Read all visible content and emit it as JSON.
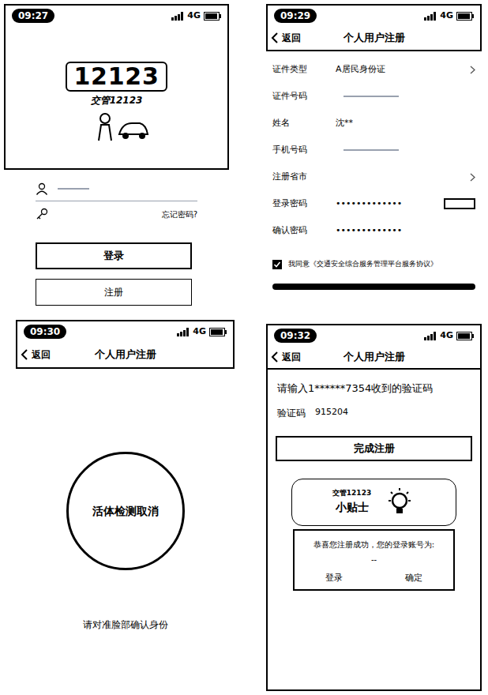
{
  "login": {
    "time": "09:27",
    "network": "4G",
    "logo_number": "12123",
    "logo_subtitle": "交管12123",
    "forgot": "忘记密码?",
    "login_button": "登录",
    "register_button": "注册"
  },
  "register": {
    "time": "09:29",
    "network": "4G",
    "back": "返回",
    "title": "个人用户注册",
    "fields": [
      {
        "label": "证件类型",
        "value": "A居民身份证",
        "kind": "select"
      },
      {
        "label": "证件号码",
        "kind": "redacted"
      },
      {
        "label": "姓名",
        "value": "沈**",
        "kind": "text"
      },
      {
        "label": "手机号码",
        "kind": "redacted"
      },
      {
        "label": "注册省市",
        "kind": "select"
      },
      {
        "label": "登录密码",
        "value": "•••••••••••••",
        "kind": "password"
      },
      {
        "label": "确认密码",
        "value": "•••••••••••••",
        "kind": "text"
      }
    ],
    "agreement": {
      "label": "我同意《交通安全综合服务管理平台服务协议》",
      "checked": true
    }
  },
  "liveness": {
    "time": "09:30",
    "network": "4G",
    "back": "返回",
    "title": "个人用户注册",
    "circle_text": "活体检测取消",
    "hint": "请对准脸部确认身份"
  },
  "verify": {
    "time": "09:32",
    "network": "4G",
    "back": "返回",
    "title": "个人用户注册",
    "prompt": "请输入1******7354收到的验证码",
    "code_label": "验证码",
    "code": "915204",
    "submit": "完成注册",
    "tip_title": "交管12123",
    "tip_subtitle": "小贴士",
    "dialog_message": "恭喜您注册成功，您的登录账号为:",
    "dialog_account": "--",
    "dialog_buttons": [
      "登录",
      "确定"
    ]
  }
}
